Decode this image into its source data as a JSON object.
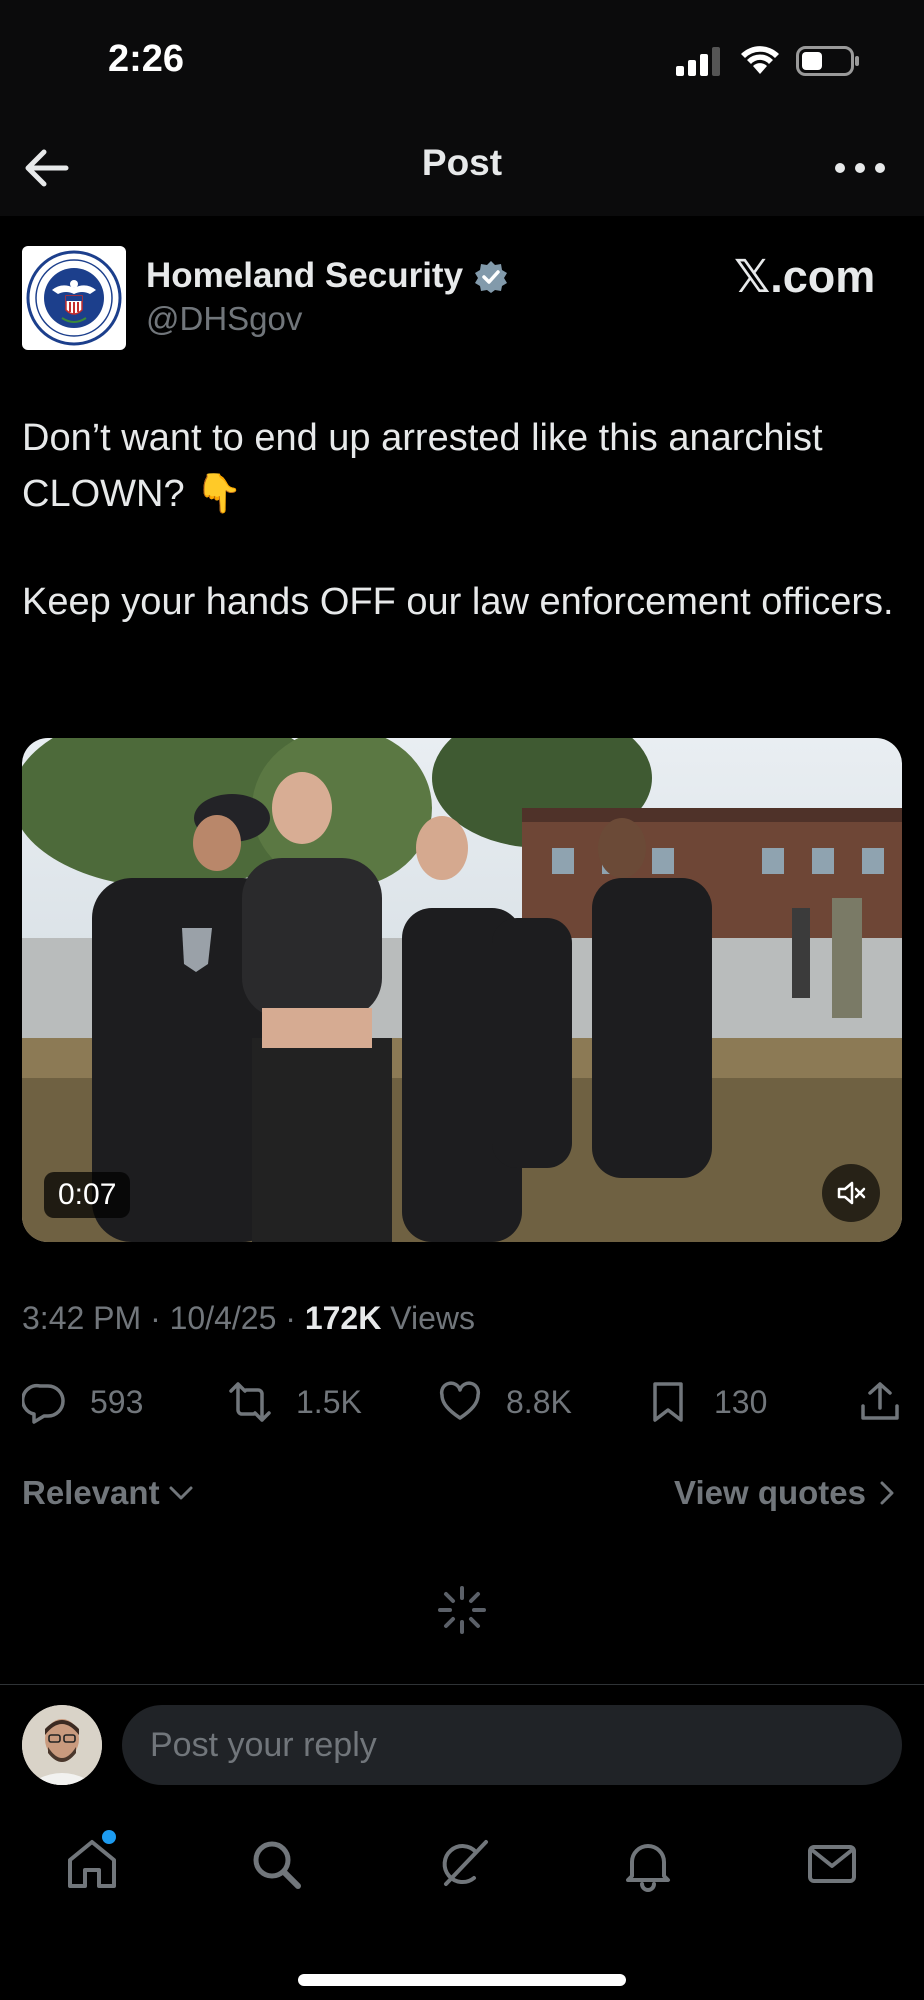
{
  "status_bar": {
    "time": "2:26"
  },
  "top_bar": {
    "title": "Post"
  },
  "author": {
    "name": "Homeland Security",
    "handle": "@DHSgov",
    "seal_text_top": "U.S. DEPARTMENT OF",
    "seal_text_bottom": "HOMELAND SECURITY"
  },
  "site_badge": "𝕏.com",
  "post": {
    "line1": "Don’t want to end up arrested like this anarchist CLOWN? 👇",
    "line2": "Keep your hands OFF our law enforcement officers."
  },
  "video": {
    "duration": "0:07"
  },
  "meta": {
    "time": "3:42 PM",
    "date": "10/4/25",
    "views_count": "172K",
    "views_label": "Views",
    "separator": "·"
  },
  "actions": {
    "replies": "593",
    "reposts": "1.5K",
    "likes": "8.8K",
    "bookmarks": "130"
  },
  "sort": {
    "relevant": "Relevant",
    "view_quotes": "View quotes"
  },
  "reply": {
    "placeholder": "Post your reply"
  },
  "colors": {
    "accent": "#1d9bf0",
    "verified": "#829aab",
    "muted": "#71767b",
    "text": "#e7e9ea"
  },
  "icons": [
    "back-arrow-icon",
    "more-icon",
    "verified-icon",
    "mute-icon",
    "reply-icon",
    "repost-icon",
    "like-icon",
    "bookmark-icon",
    "share-icon",
    "chevron-down-icon",
    "chevron-right-icon",
    "spinner-icon",
    "home-icon",
    "search-icon",
    "grok-icon",
    "notifications-icon",
    "messages-icon"
  ]
}
